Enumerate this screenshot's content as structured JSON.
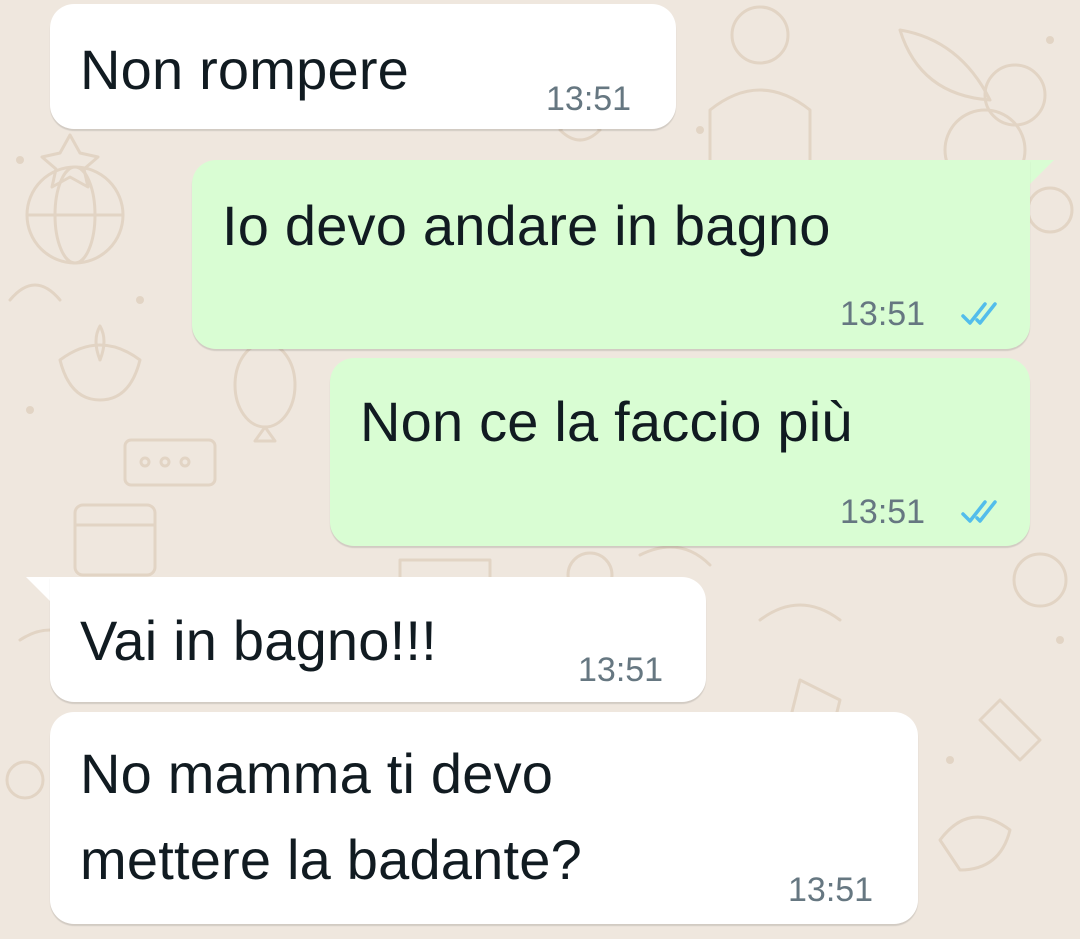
{
  "chat": {
    "messages": [
      {
        "direction": "incoming",
        "text_lines": [
          "Non rompere"
        ],
        "time": "13:51"
      },
      {
        "direction": "outgoing",
        "text_lines": [
          "Io devo andare in bagno"
        ],
        "time": "13:51",
        "status": "read"
      },
      {
        "direction": "outgoing",
        "text_lines": [
          "Non ce la faccio più"
        ],
        "time": "13:51",
        "status": "read"
      },
      {
        "direction": "incoming",
        "text_lines": [
          "Vai in bagno!!!"
        ],
        "time": "13:51"
      },
      {
        "direction": "incoming",
        "text_lines": [
          "No mamma ti devo",
          "mettere la badante?"
        ],
        "time": "13:51"
      }
    ]
  },
  "colors": {
    "wallpaper": "#efe7de",
    "incoming_bubble": "#ffffff",
    "outgoing_bubble": "#d9fdd3",
    "read_ticks": "#53bdeb",
    "time_text": "#667781"
  },
  "icons": {
    "read_status": "double-check-icon"
  }
}
